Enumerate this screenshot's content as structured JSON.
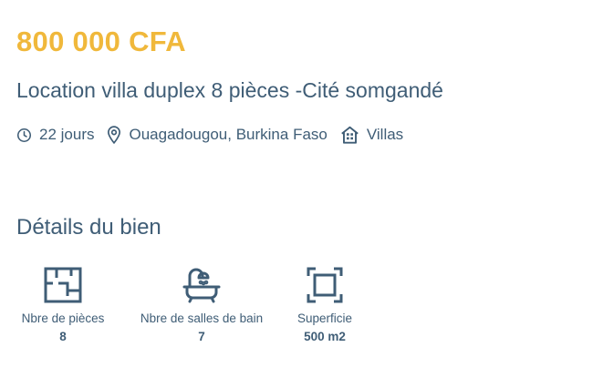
{
  "listing": {
    "price": "800 000 CFA",
    "title": "Location villa duplex 8 pièces -Cité somgandé",
    "meta": {
      "age": "22 jours",
      "location": "Ouagadougou, Burkina Faso",
      "category": "Villas"
    }
  },
  "details": {
    "heading": "Détails du bien",
    "features": [
      {
        "label": "Nbre de pièces",
        "value": "8",
        "icon": "floor-plan-icon"
      },
      {
        "label": "Nbre de salles de bain",
        "value": "7",
        "icon": "bathtub-icon"
      },
      {
        "label": "Superficie",
        "value": "500 m2",
        "icon": "area-icon"
      }
    ]
  },
  "colors": {
    "price": "#f0b83b",
    "text": "#3f5d76"
  }
}
